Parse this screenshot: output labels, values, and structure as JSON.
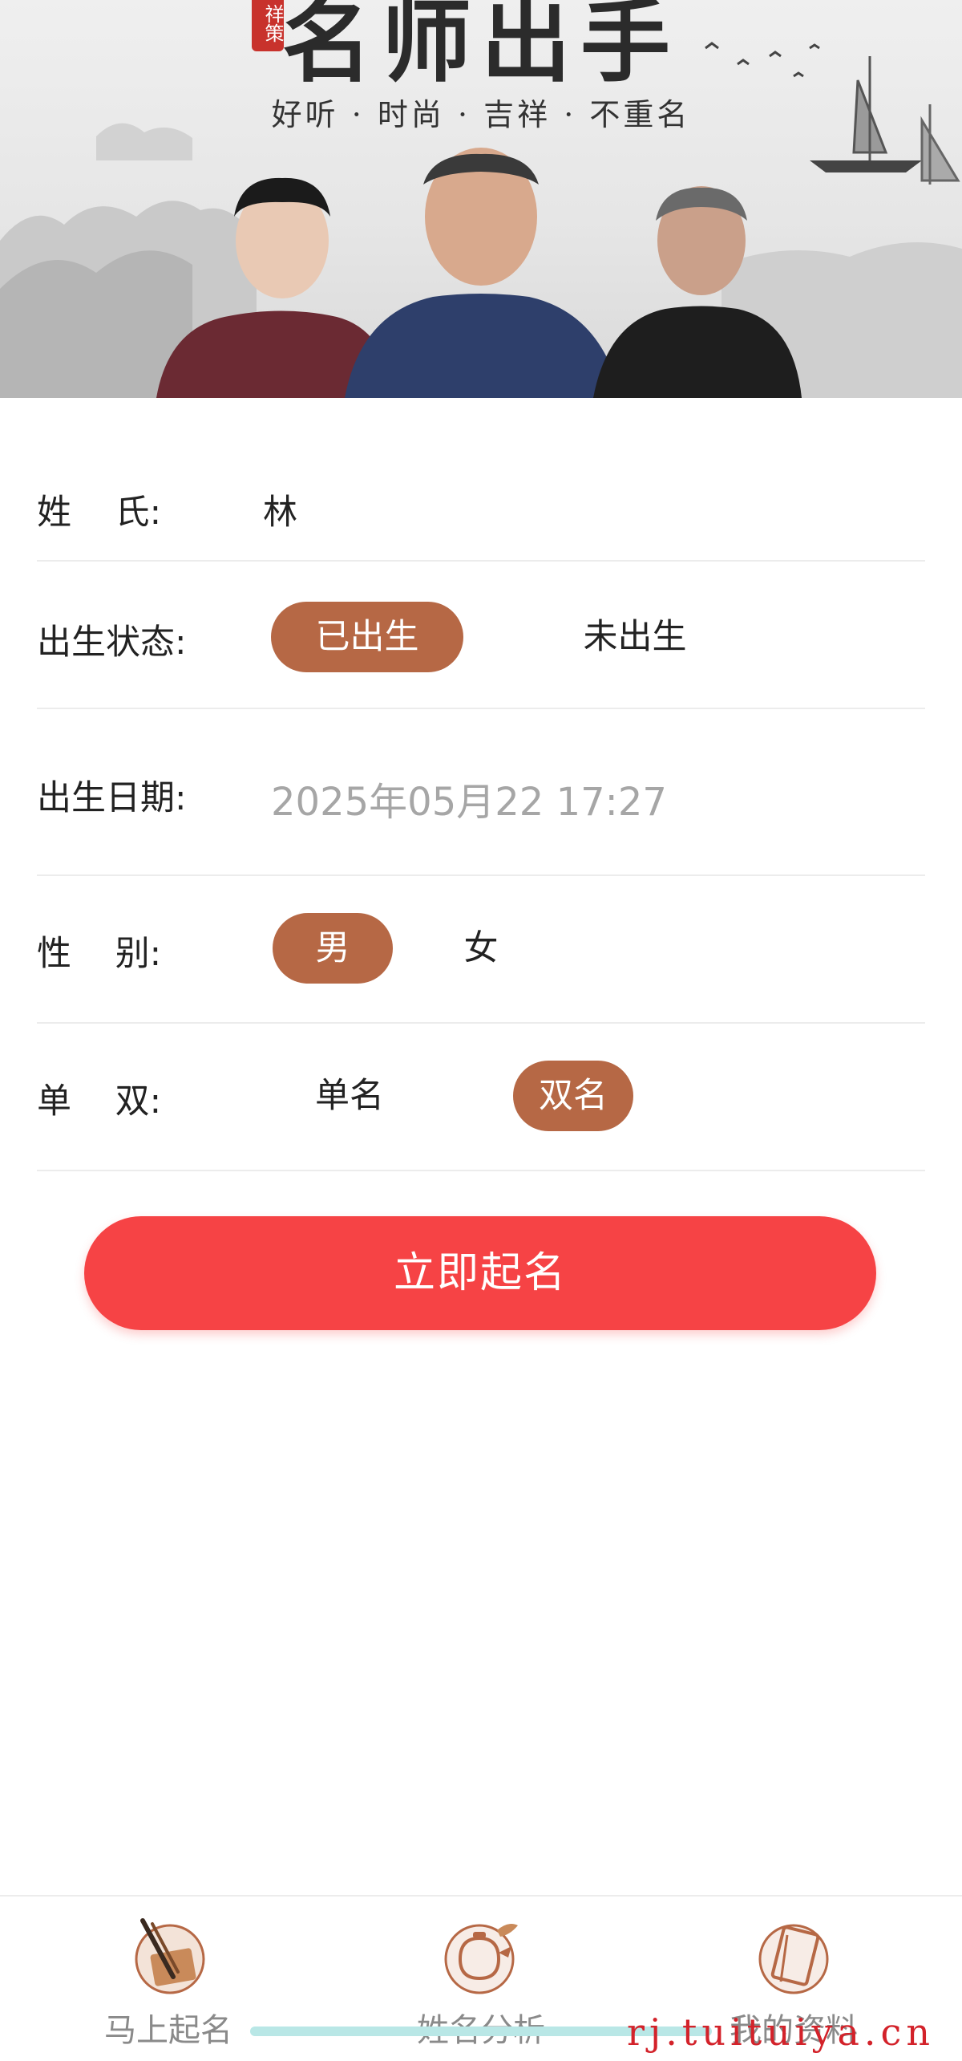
{
  "banner": {
    "title": "名师出手",
    "seal": "祥策",
    "subtitle": "好听 · 时尚 · 吉祥 · 不重名"
  },
  "form": {
    "surname": {
      "label": "姓    氏:",
      "value": "林"
    },
    "birth_status": {
      "label": "出生状态:",
      "options": [
        "已出生",
        "未出生"
      ],
      "selected": "已出生"
    },
    "birth_date": {
      "label": "出生日期:",
      "value": "2025年05月22 17:27"
    },
    "gender": {
      "label": "性    别:",
      "options": [
        "男",
        "女"
      ],
      "selected": "男"
    },
    "name_length": {
      "label": "单    双:",
      "options": [
        "单名",
        "双名"
      ],
      "selected": "双名"
    }
  },
  "submit_label": "立即起名",
  "bottom_nav": {
    "items": [
      {
        "label": "马上起名",
        "icon": "brush-icon"
      },
      {
        "label": "姓名分析",
        "icon": "teapot-icon"
      },
      {
        "label": "我的资料",
        "icon": "book-icon"
      }
    ]
  },
  "watermark": "rj.tuituiya.cn",
  "colors": {
    "accent": "#b66845",
    "submit": "#f64345",
    "placeholder": "#a6a6a6"
  }
}
